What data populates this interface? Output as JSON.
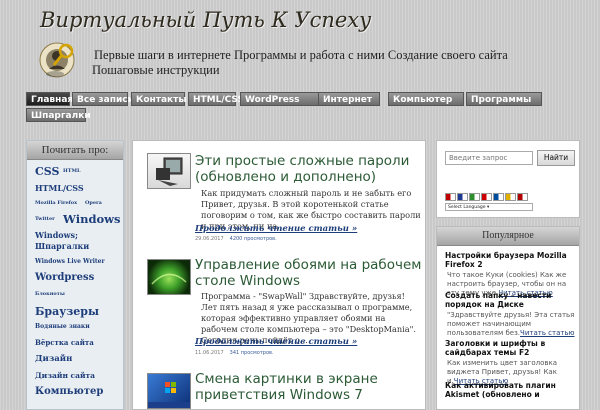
{
  "header": {
    "title": "Виртуальный Путь К Успеху",
    "tagline": "Первые шаги в интернете Программы и работа с ними Создание своего сайта Пошаговые инструкции"
  },
  "nav": {
    "items": [
      {
        "label": "Главная",
        "active": true
      },
      {
        "label": "Все записи"
      },
      {
        "label": "Контакты"
      },
      {
        "label": "HTML/CSS"
      },
      {
        "label": "WordPress"
      },
      {
        "label": "Интернет"
      },
      {
        "label": "Компьютер"
      },
      {
        "label": "Программы"
      },
      {
        "label": "Шпаргалки"
      }
    ]
  },
  "sidebar": {
    "heading": "Почитать про:",
    "tags": [
      {
        "label": "CSS"
      },
      {
        "label": "HTML"
      },
      {
        "label": "HTML/CSS"
      },
      {
        "label": "Mozilla Firefox"
      },
      {
        "label": "Opera"
      },
      {
        "label": "Twitter"
      },
      {
        "label": "Windows"
      },
      {
        "label": "Windows; Шпаргалки"
      },
      {
        "label": "Windows Live Writer"
      },
      {
        "label": "Wordpress"
      },
      {
        "label": "Блокноты"
      },
      {
        "label": "Браузеры"
      },
      {
        "label": "Водяные знаки"
      },
      {
        "label": "Вёрстка сайта"
      },
      {
        "label": "Дизайн"
      },
      {
        "label": "Дизайн сайта"
      },
      {
        "label": "Компьютер"
      }
    ]
  },
  "posts": [
    {
      "title": "Эти простые сложные пароли (обновлено и дополнено)",
      "excerpt": "Как придумать сложный пароль и не забыть его Привет, друзья. В этой коротенькой статье поговорим о том, как же быстро составить пароли и при этом, ни на...",
      "read_more": "Продолжить чтение статьи »",
      "date": "29.06.2017",
      "views": "4200 просмотров."
    },
    {
      "title": "Управление обоями на рабочем столе Windows",
      "excerpt": "Программа - \"SwapWall\" Здравствуйте, друзья! Лет пять назад я уже рассказывал о программе, которая эффективно управляет обоями на рабочем столе компьютера – это \"DesktopMania\". Сегодня речь пойдёт о...",
      "read_more": "Продолжить чтение статьи »",
      "date": "11.06.2017",
      "views": "341 просмотров."
    },
    {
      "title": "Смена картинки в экране приветствия Windows 7"
    }
  ],
  "search": {
    "placeholder": "Введите запрос",
    "button": "Найти"
  },
  "language": {
    "select_label": "Select Language",
    "flags": [
      "#c00000",
      "#1f3a93",
      "#2f8f2f",
      "#cc0000",
      "#004ea0",
      "#e0b000",
      "#b00000"
    ]
  },
  "popular": {
    "heading": "Популярное",
    "items": [
      {
        "title": "Настройки браузера Mozilla Firefox 2",
        "excerpt": "Что такое Куки (cookies) Как же настроить браузер, чтобы он на эту тему уже.",
        "link": "Читать статью"
      },
      {
        "title": "Создать папку – навести порядок на Диске",
        "excerpt": "\"Здравствуйте друзья! Эта статья поможет начинающим пользователям без.",
        "link": "Читать статью"
      },
      {
        "title": "Заголовки и шрифты в сайдбарах темы F2",
        "excerpt": "Как изменить цвет заголовка виджета Привет, друзья! Как и.",
        "link": "Читать статью"
      },
      {
        "title": "Как активировать плагин Akismet (обновлено и"
      }
    ]
  },
  "colors": {
    "accent": "#1d3d7a",
    "post_title": "#2b5a35"
  }
}
